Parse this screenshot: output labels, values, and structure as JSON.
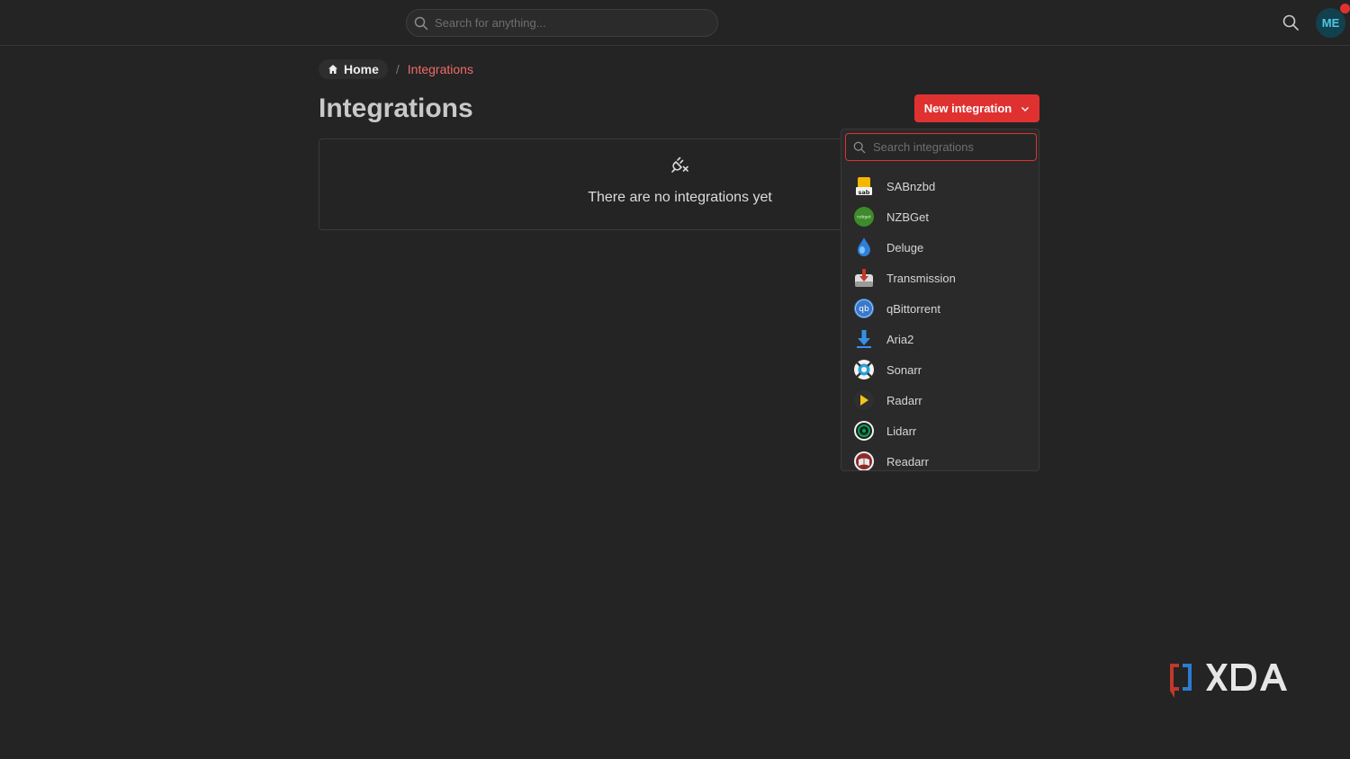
{
  "header": {
    "search_placeholder": "Search for anything...",
    "avatar_initials": "ME"
  },
  "breadcrumb": {
    "home": "Home",
    "separator": "/",
    "current": "Integrations"
  },
  "page": {
    "title": "Integrations",
    "new_button_label": "New integration",
    "empty_message": "There are no integrations yet"
  },
  "dropdown": {
    "search_placeholder": "Search integrations",
    "items": [
      {
        "label": "SABnzbd",
        "icon": "sabnzbd-icon"
      },
      {
        "label": "NZBGet",
        "icon": "nzbget-icon"
      },
      {
        "label": "Deluge",
        "icon": "deluge-icon"
      },
      {
        "label": "Transmission",
        "icon": "transmission-icon"
      },
      {
        "label": "qBittorrent",
        "icon": "qbittorrent-icon"
      },
      {
        "label": "Aria2",
        "icon": "aria2-icon"
      },
      {
        "label": "Sonarr",
        "icon": "sonarr-icon"
      },
      {
        "label": "Radarr",
        "icon": "radarr-icon"
      },
      {
        "label": "Lidarr",
        "icon": "lidarr-icon"
      },
      {
        "label": "Readarr",
        "icon": "readarr-icon"
      }
    ]
  },
  "colors": {
    "accent": "#e03131",
    "breadcrumb_active": "#f06a6a",
    "background": "#242424"
  }
}
